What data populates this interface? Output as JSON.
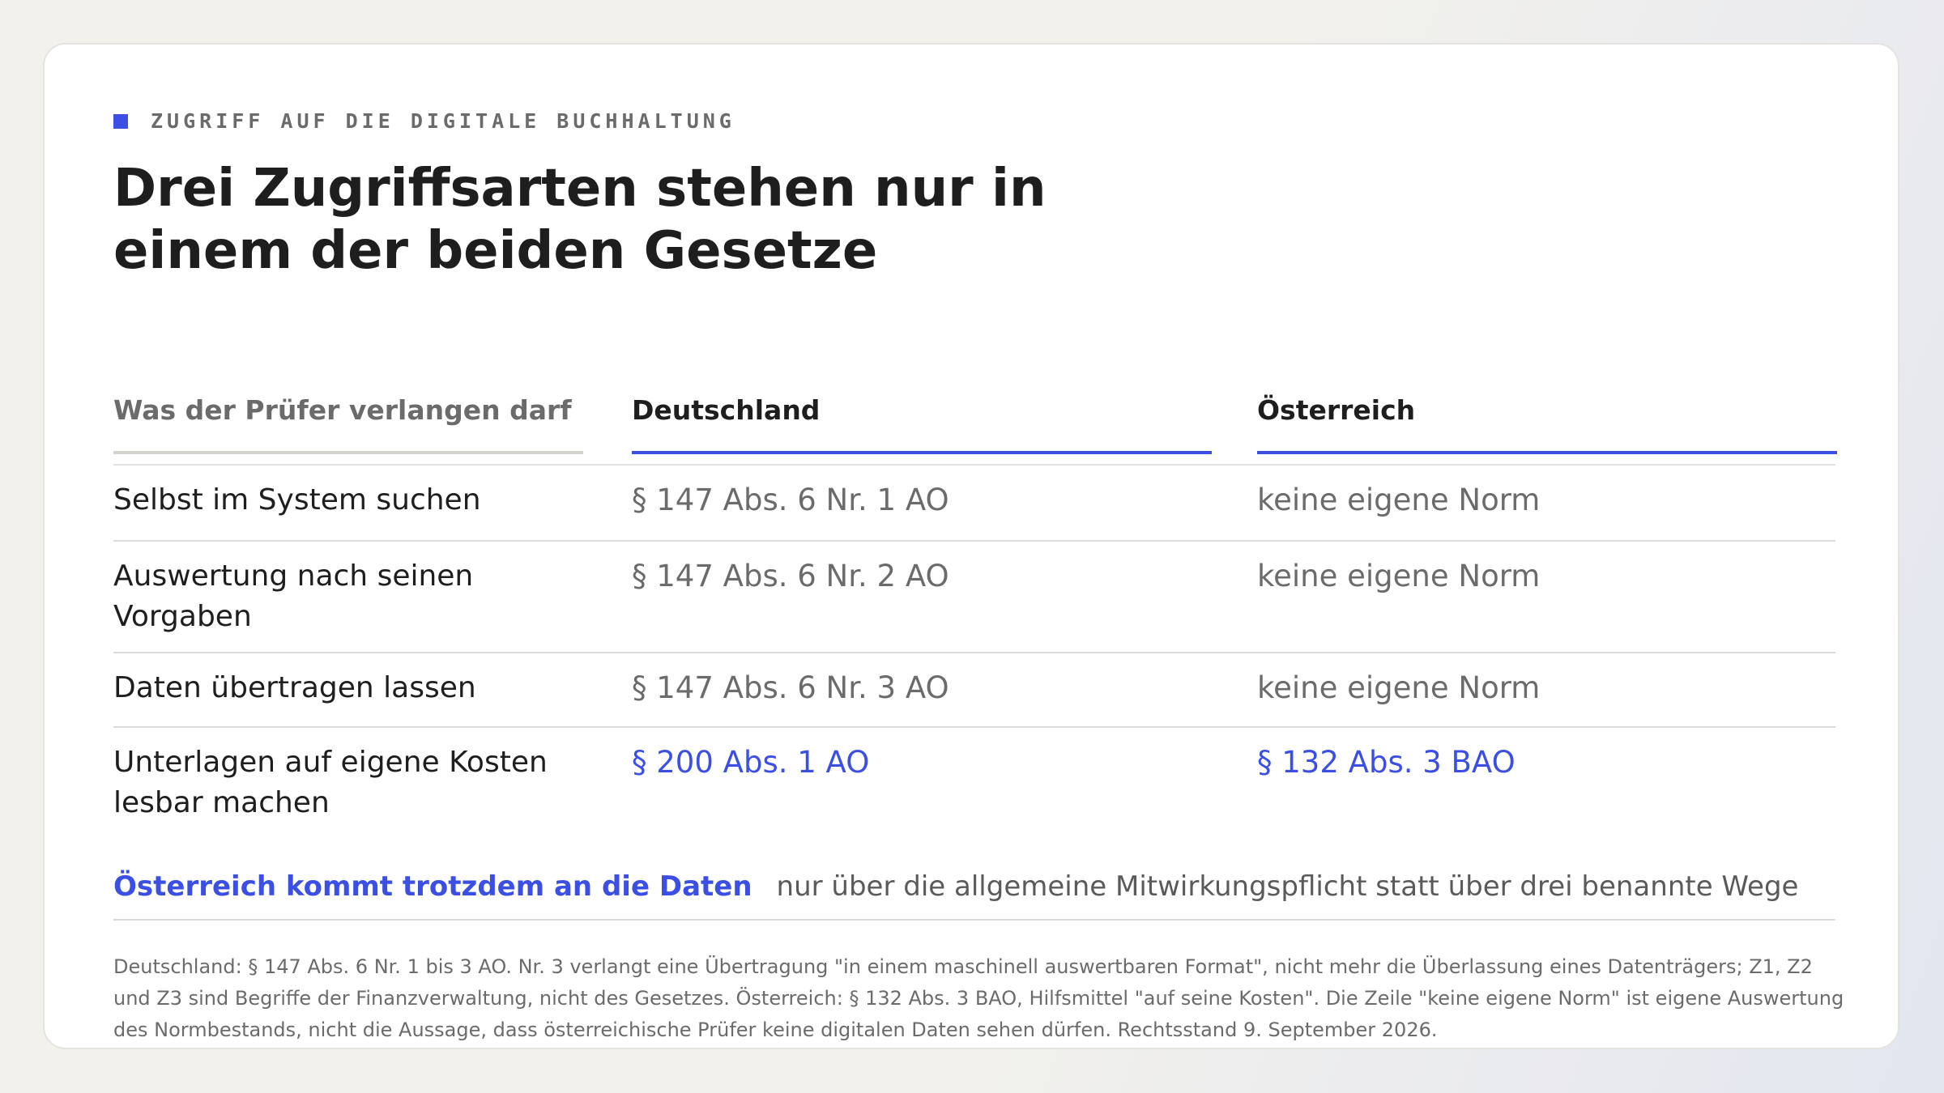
{
  "eyebrow": "ZUGRIFF AUF DIE DIGITALE BUCHHALTUNG",
  "title": "Drei Zugriffsarten stehen nur in einem der beiden Gesetze",
  "colors": {
    "accent": "#3b4fe4",
    "text": "#1e1e1e",
    "muted": "#6b6b6b"
  },
  "table": {
    "headers": [
      "Was der Prüfer verlangen darf",
      "Deutschland",
      "Österreich"
    ],
    "rows": [
      {
        "label": "Selbst im System suchen",
        "de": "§ 147 Abs. 6 Nr. 1 AO",
        "at": "keine eigene Norm"
      },
      {
        "label": "Auswertung nach seinen Vorgaben",
        "de": "§ 147 Abs. 6 Nr. 2 AO",
        "at": "keine eigene Norm"
      },
      {
        "label": "Daten übertragen lassen",
        "de": "§ 147 Abs. 6 Nr. 3 AO",
        "at": "keine eigene Norm"
      },
      {
        "label": "Unterlagen auf eigene Kosten lesbar machen",
        "de": "§ 200 Abs. 1 AO",
        "at": "§ 132 Abs. 3 BAO"
      }
    ]
  },
  "callout": {
    "strong": "Österreich kommt trotzdem an die Daten",
    "text": "nur über die allgemeine Mitwirkungspflicht statt über drei benannte Wege"
  },
  "footnote": "Deutschland: § 147 Abs. 6 Nr. 1 bis 3 AO. Nr. 3 verlangt eine Übertragung \"in einem maschinell auswertbaren Format\", nicht mehr die Überlassung eines Datenträgers; Z1, Z2 und Z3 sind Begriffe der Finanzverwaltung, nicht des Gesetzes. Österreich: § 132 Abs. 3 BAO, Hilfsmittel \"auf seine Kosten\". Die Zeile \"keine eigene Norm\" ist eigene Auswertung des Normbestands, nicht die Aussage, dass österreichische Prüfer keine digitalen Daten sehen dürfen. Rechtsstand 9. September 2026."
}
